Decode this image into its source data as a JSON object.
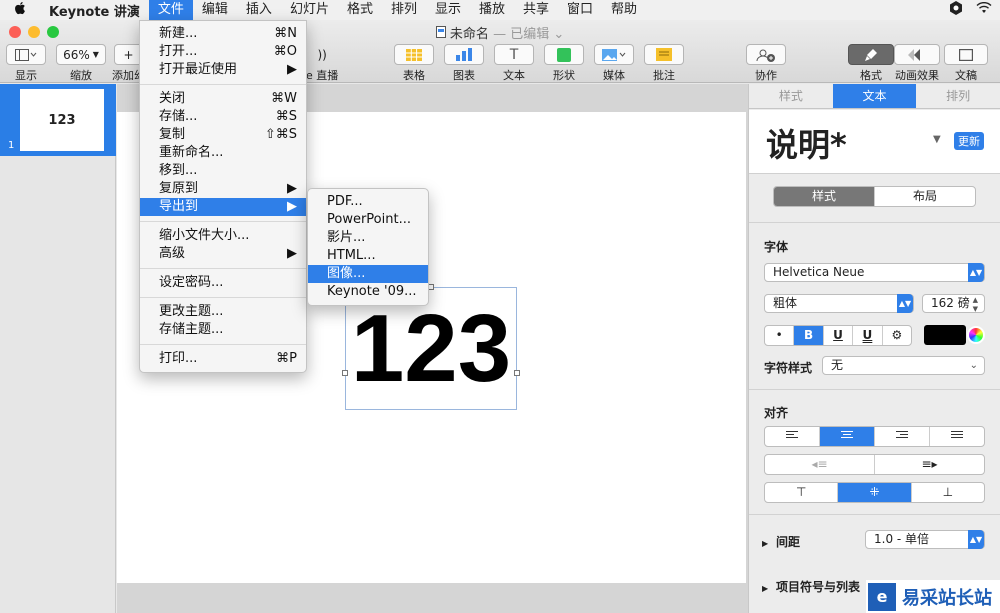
{
  "menubar": {
    "apple": "",
    "app_name": "Keynote 讲演",
    "items": [
      "文件",
      "编辑",
      "插入",
      "幻灯片",
      "格式",
      "排列",
      "显示",
      "播放",
      "共享",
      "窗口",
      "帮助"
    ]
  },
  "window": {
    "doc_title": "未命名",
    "doc_status": "— 已编辑 ⌄"
  },
  "toolbar": {
    "view": {
      "label": "显示"
    },
    "zoom": {
      "value": "66%",
      "label": "缩放"
    },
    "add_slide": {
      "label": "添加幻"
    },
    "live": {
      "label": "e 直播"
    },
    "table": {
      "label": "表格"
    },
    "chart": {
      "label": "图表"
    },
    "text": {
      "label": "文本"
    },
    "shape": {
      "label": "形状"
    },
    "media": {
      "label": "媒体"
    },
    "comment": {
      "label": "批注"
    },
    "collaborate": {
      "label": "协作"
    },
    "format": {
      "label": "格式"
    },
    "animate": {
      "label": "动画效果"
    },
    "document": {
      "label": "文稿"
    }
  },
  "navigator": {
    "slide_text": "123",
    "slide_number": "1"
  },
  "slide": {
    "text": "123"
  },
  "inspector": {
    "tabs": [
      "样式",
      "文本",
      "排列"
    ],
    "paragraph_style": "说明*",
    "update_button": "更新",
    "sub_tabs": [
      "样式",
      "布局"
    ],
    "font_section": "字体",
    "font_family": "Helvetica Neue",
    "font_weight": "粗体",
    "font_size": "162 磅",
    "bullet": "•",
    "bold": "B",
    "underline": "U",
    "double_underline": "U",
    "gear": "⚙",
    "char_style_label": "字符样式",
    "char_style_value": "无",
    "align_section": "对齐",
    "spacing_label": "间距",
    "spacing_value": "1.0 - 单倍",
    "bullets_label": "项目符号与列表"
  },
  "file_menu": {
    "items": [
      {
        "label": "新建...",
        "shortcut": "⌘N"
      },
      {
        "label": "打开...",
        "shortcut": "⌘O"
      },
      {
        "label": "打开最近使用",
        "shortcut": "▶"
      },
      {
        "label": "关闭",
        "shortcut": "⌘W"
      },
      {
        "label": "存储...",
        "shortcut": "⌘S"
      },
      {
        "label": "复制",
        "shortcut": "⇧⌘S"
      },
      {
        "label": "重新命名...",
        "shortcut": ""
      },
      {
        "label": "移到...",
        "shortcut": ""
      },
      {
        "label": "复原到",
        "shortcut": "▶"
      },
      {
        "label": "导出到",
        "shortcut": "▶"
      },
      {
        "label": "缩小文件大小...",
        "shortcut": ""
      },
      {
        "label": "高级",
        "shortcut": "▶"
      },
      {
        "label": "设定密码...",
        "shortcut": ""
      },
      {
        "label": "更改主题...",
        "shortcut": ""
      },
      {
        "label": "存储主题...",
        "shortcut": ""
      },
      {
        "label": "打印...",
        "shortcut": "⌘P"
      }
    ]
  },
  "export_submenu": {
    "items": [
      "PDF...",
      "PowerPoint...",
      "影片...",
      "HTML...",
      "图像...",
      "Keynote '09..."
    ]
  },
  "watermark": {
    "text": "易采站长站"
  },
  "colors": {
    "accent": "#2f7fe8",
    "text_color_swatch": "#000000"
  }
}
